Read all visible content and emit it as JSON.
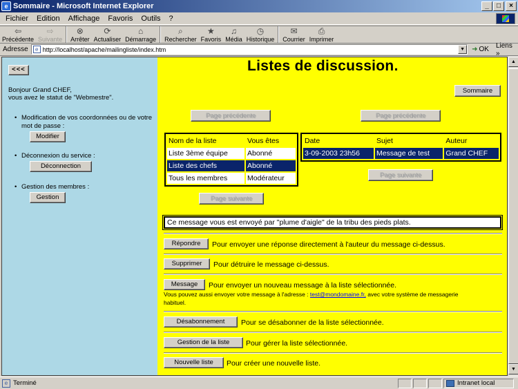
{
  "window": {
    "title": "Sommaire - Microsoft Internet Explorer"
  },
  "menu": [
    "Fichier",
    "Edition",
    "Affichage",
    "Favoris",
    "Outils",
    "?"
  ],
  "toolbar": [
    {
      "label": "Précédente",
      "icon": "back-arrow-icon",
      "glyph": "⇦",
      "disabled": false
    },
    {
      "label": "Suivante",
      "icon": "forward-arrow-icon",
      "glyph": "⇨",
      "disabled": true
    },
    {
      "label": "Arrêter",
      "icon": "stop-icon",
      "glyph": "⊗",
      "disabled": false
    },
    {
      "label": "Actualiser",
      "icon": "refresh-icon",
      "glyph": "⟳",
      "disabled": false
    },
    {
      "label": "Démarrage",
      "icon": "home-icon",
      "glyph": "⌂",
      "disabled": false
    },
    {
      "label": "Rechercher",
      "icon": "search-icon",
      "glyph": "⌕",
      "disabled": false
    },
    {
      "label": "Favoris",
      "icon": "favorites-icon",
      "glyph": "★",
      "disabled": false
    },
    {
      "label": "Média",
      "icon": "media-icon",
      "glyph": "♫",
      "disabled": false
    },
    {
      "label": "Historique",
      "icon": "history-icon",
      "glyph": "◷",
      "disabled": false
    },
    {
      "label": "Courrier",
      "icon": "mail-icon",
      "glyph": "✉",
      "disabled": false
    },
    {
      "label": "Imprimer",
      "icon": "print-icon",
      "glyph": "⎙",
      "disabled": false
    }
  ],
  "address": {
    "label": "Adresse",
    "url": "http://localhost/apache/mailingliste/index.htm",
    "go_label": "OK",
    "links_label": "Liens"
  },
  "left": {
    "back_label": "<<<",
    "greeting_line1": "Bonjour Grand CHEF,",
    "greeting_line2": "vous avez le statut de \"Webmestre\".",
    "items": [
      {
        "text": "Modification de vos coordonnées ou de votre mot de passe :",
        "button": "Modifier"
      },
      {
        "text": "Déconnexion du service :",
        "button": "Déconnection"
      },
      {
        "text": "Gestion des membres :",
        "button": "Gestion"
      }
    ]
  },
  "main": {
    "title": "Listes de discussion.",
    "sommaire_label": "Sommaire",
    "prev_page_label": "Page précédente",
    "next_page_label": "Page suivante",
    "lists_table": {
      "headers": [
        "Nom de la liste",
        "Vous êtes"
      ],
      "rows": [
        [
          "Liste 3ème équipe",
          "Abonné"
        ],
        [
          "Liste des chefs",
          "Abonné"
        ],
        [
          "Tous les membres",
          "Modérateur"
        ]
      ]
    },
    "messages_table": {
      "headers": [
        "Date",
        "Sujet",
        "Auteur"
      ],
      "rows": [
        [
          "3-09-2003 23h56",
          "Message de test",
          "Grand CHEF"
        ]
      ]
    },
    "message_text": "Ce message vous est envoyé par \"plume d'aigle\" de la tribu des pieds plats.",
    "actions": [
      {
        "button": "Répondre",
        "desc": "Pour envoyer une réponse directement à l'auteur du message ci-dessus."
      },
      {
        "button": "Supprimer",
        "desc": "Pour détruire le message ci-dessus."
      },
      {
        "button": "Message",
        "desc": "Pour envoyer un nouveau message à la liste sélectionnée."
      },
      {
        "button": "Désabonnement",
        "desc": "Pour se désabonner de la liste sélectionnée."
      },
      {
        "button": "Gestion de la liste",
        "desc": "Pour gérer la liste sélectionnée."
      },
      {
        "button": "Nouvelle liste",
        "desc": "Pour créer une nouvelle liste."
      }
    ],
    "note_before": "Vous pouvez aussi envoyer votre message à l'adresse :",
    "note_email": "test@mondomaine.fr,",
    "note_after1": "avec votre système de messagerie",
    "note_after2": "habituel."
  },
  "status": {
    "text": "Terminé",
    "zone": "Intranet local"
  }
}
